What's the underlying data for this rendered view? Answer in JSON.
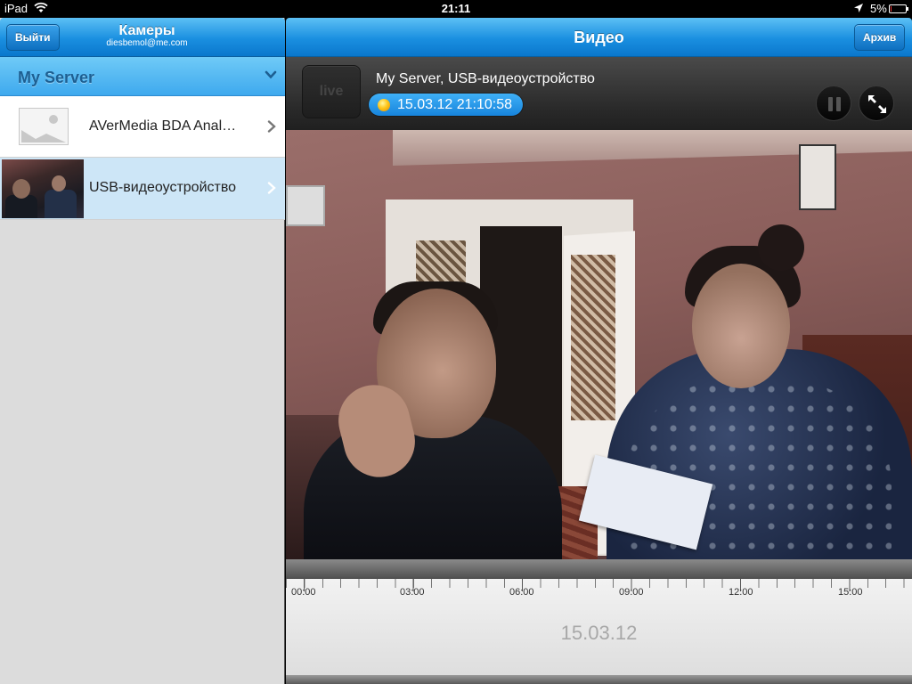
{
  "status_bar": {
    "carrier": "iPad",
    "time": "21:11",
    "battery": "5%",
    "battery_level": 0.05
  },
  "left_nav": {
    "logout_label": "Выйти",
    "title": "Камеры",
    "subtitle": "diesbemol@me.com"
  },
  "server": {
    "name": "My Server"
  },
  "cameras": [
    {
      "name": "AVerMedia BDA Anal…",
      "selected": false
    },
    {
      "name": "USB-видеоустройство",
      "selected": true
    }
  ],
  "right_nav": {
    "title": "Видео",
    "archive_label": "Архив"
  },
  "player": {
    "live_label": "live",
    "title": "My Server, USB-видеоустройство",
    "timestamp": "15.03.12 21:10:58"
  },
  "timeline": {
    "ticks": [
      "00:00",
      "03:00",
      "06:00",
      "09:00",
      "12:00",
      "15:00"
    ],
    "date": "15.03.12"
  },
  "colors": {
    "nav_blue": "#1a8fe0",
    "selected_row": "#cde6f7",
    "server_text": "#1d5f92",
    "pill_blue": "#1784dc"
  },
  "icons": {
    "wifi": "wifi-icon",
    "location": "location-arrow-icon",
    "battery": "battery-icon",
    "chevron_down": "chevron-down-icon",
    "chevron_right": "chevron-right-icon",
    "pause": "pause-icon",
    "fullscreen": "fullscreen-icon"
  }
}
